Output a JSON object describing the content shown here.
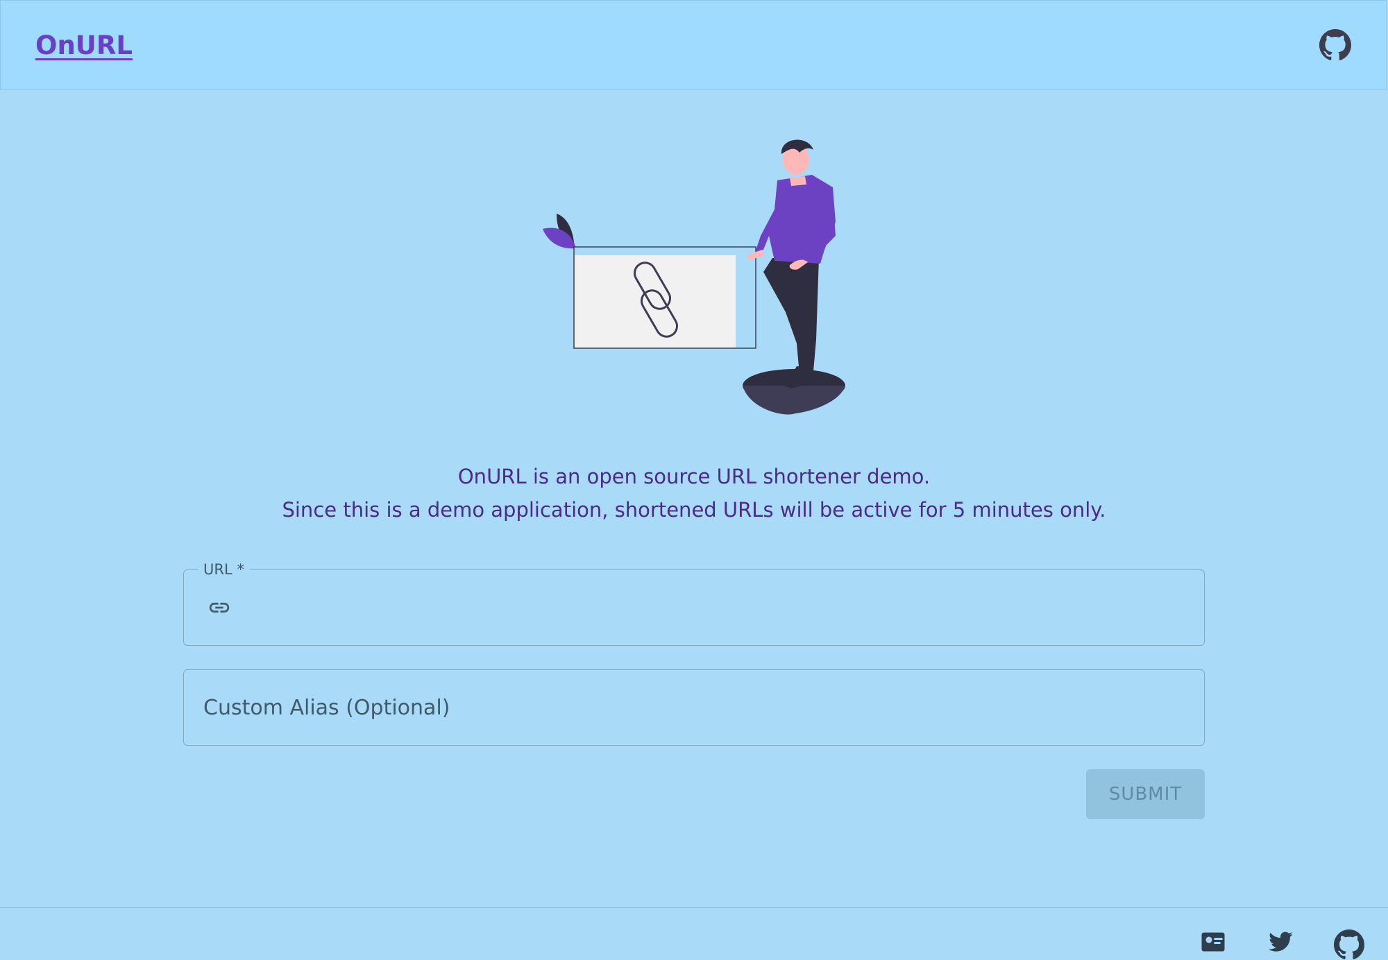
{
  "header": {
    "brand": "OnURL",
    "github_icon": "github-icon"
  },
  "description": {
    "line1": "OnURL is an open source URL shortener demo.",
    "line2": "Since this is a demo application, shortened URLs will be active for 5 minutes only."
  },
  "form": {
    "url": {
      "label": "URL *",
      "value": "",
      "icon": "link-icon"
    },
    "alias": {
      "placeholder": "Custom Alias (Optional)",
      "value": ""
    },
    "submit_label": "SUBMIT"
  },
  "footer": {
    "icons": [
      "contact-card-icon",
      "twitter-icon",
      "github-icon"
    ]
  },
  "colors": {
    "background": "#a9dbf8",
    "app_bar": "#9fdbfe",
    "brand": "#6a3fc4",
    "text": "#4b2a8a",
    "submit_disabled": "#92c3de"
  }
}
